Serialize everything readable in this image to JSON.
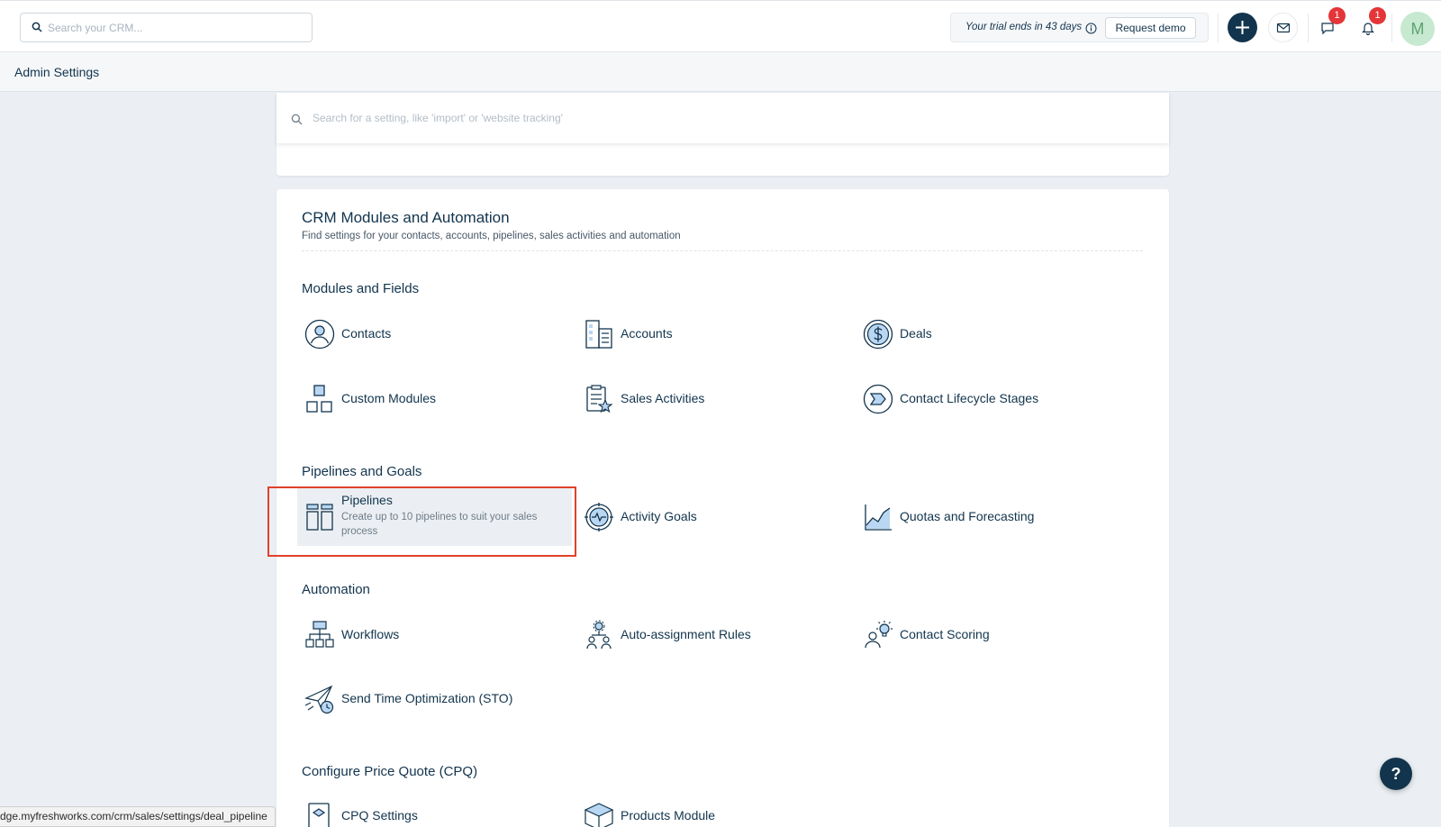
{
  "topbar": {
    "search_placeholder": "Search your CRM...",
    "trial_text": "Your trial ends in 43 days",
    "request_demo_label": "Request demo",
    "chat_badge": "1",
    "notification_badge": "1",
    "avatar_initial": "M"
  },
  "subheader": {
    "title": "Admin Settings"
  },
  "settings_search": {
    "placeholder": "Search for a setting, like 'import' or 'website tracking'"
  },
  "main": {
    "title": "CRM Modules and Automation",
    "subtitle": "Find settings for your contacts, accounts, pipelines, sales activities and automation",
    "sections": [
      {
        "title": "Modules and Fields",
        "items": [
          {
            "label": "Contacts",
            "icon": "contact-icon"
          },
          {
            "label": "Accounts",
            "icon": "accounts-building-icon"
          },
          {
            "label": "Deals",
            "icon": "deals-dollar-icon"
          },
          {
            "label": "Custom Modules",
            "icon": "custom-modules-icon"
          },
          {
            "label": "Sales Activities",
            "icon": "sales-activities-icon"
          },
          {
            "label": "Contact Lifecycle Stages",
            "icon": "lifecycle-icon"
          }
        ]
      },
      {
        "title": "Pipelines and Goals",
        "items": [
          {
            "label": "Pipelines",
            "description": "Create up to 10 pipelines to suit your sales process",
            "icon": "pipelines-icon"
          },
          {
            "label": "Activity Goals",
            "icon": "activity-goals-icon"
          },
          {
            "label": "Quotas and Forecasting",
            "icon": "quotas-chart-icon"
          }
        ]
      },
      {
        "title": "Automation",
        "items": [
          {
            "label": "Workflows",
            "icon": "workflows-icon"
          },
          {
            "label": "Auto-assignment Rules",
            "icon": "auto-assignment-icon"
          },
          {
            "label": "Contact Scoring",
            "icon": "contact-scoring-icon"
          },
          {
            "label": "Send Time Optimization (STO)",
            "icon": "send-time-icon"
          }
        ]
      },
      {
        "title": "Configure Price Quote (CPQ)",
        "items": [
          {
            "label": "CPQ Settings",
            "icon": "cpq-settings-icon"
          },
          {
            "label": "Products Module",
            "icon": "products-module-icon"
          }
        ]
      }
    ]
  },
  "status_url": "dge.myfreshworks.com/crm/sales/settings/deal_pipeline",
  "help_label": "?",
  "colors": {
    "primary": "#12344d",
    "accent_icon": "#2c5cc5",
    "icon_fill": "#b9d6f2",
    "badge": "#e43538",
    "highlight_frame": "#e0412a"
  }
}
